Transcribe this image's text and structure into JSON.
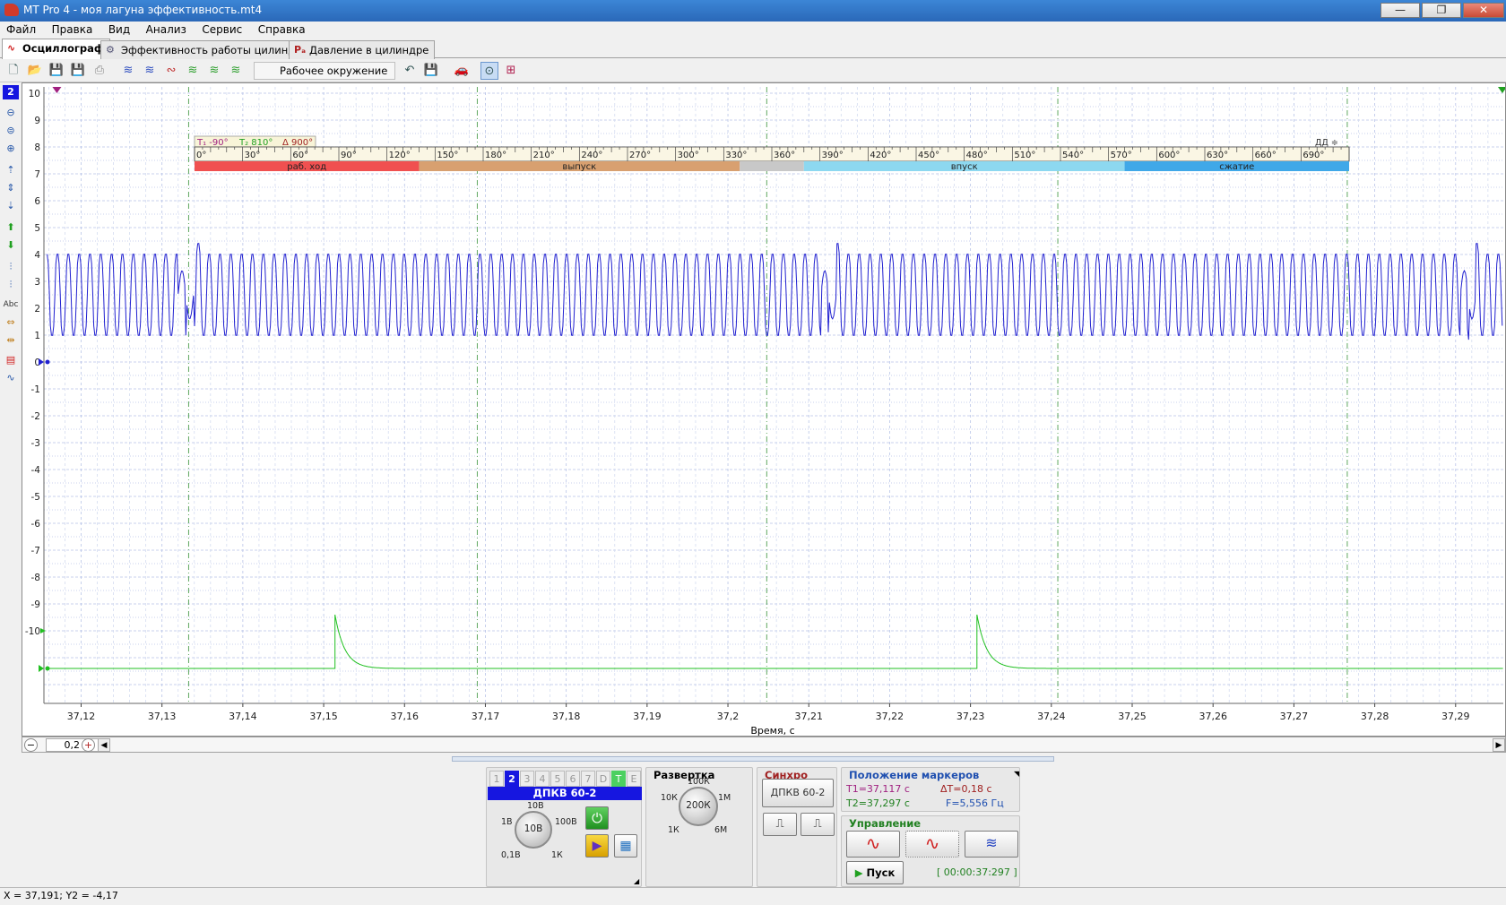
{
  "window": {
    "title": "MT Pro 4 - моя лагуна эффективность.mt4",
    "minimize": "—",
    "maximize": "❐",
    "close": "✕"
  },
  "menu": [
    "Файл",
    "Правка",
    "Вид",
    "Анализ",
    "Сервис",
    "Справка"
  ],
  "tabs": [
    {
      "label": "Осциллограф",
      "icon": "sine-wave-icon"
    },
    {
      "label": "Эффективность работы цилиндров",
      "icon": "gear-chart-icon"
    },
    {
      "label": "Давление в цилиндре",
      "icon": "pressure-icon"
    }
  ],
  "toolbar": {
    "workspace": "Рабочее окружение"
  },
  "plot": {
    "y_ticks": [
      "10",
      "9",
      "8",
      "7",
      "6",
      "5",
      "4",
      "3",
      "2",
      "1",
      "0",
      "-1",
      "-2",
      "-3",
      "-4",
      "-5",
      "-6",
      "-7",
      "-8",
      "-9",
      "-10"
    ],
    "x_ticks": [
      "37,12",
      "37,13",
      "37,14",
      "37,15",
      "37,16",
      "37,17",
      "37,18",
      "37,19",
      "37,2",
      "37,21",
      "37,22",
      "37,23",
      "37,24",
      "37,25",
      "37,26",
      "37,27",
      "37,28",
      "37,29"
    ],
    "x_title": "Время, с",
    "channel_badge": "2",
    "x_range": [
      37.1154,
      37.2959
    ]
  },
  "crank_overlay": {
    "t1_label": "T₁ -90°",
    "t2_label": "T₂ 810°",
    "delta_label": "Δ 900°",
    "ratio_label": "ДД ≑",
    "degree_labels": [
      "0°",
      "30°",
      "60°",
      "90°",
      "120°",
      "150°",
      "180°",
      "210°",
      "240°",
      "270°",
      "300°",
      "330°",
      "360°",
      "390°",
      "420°",
      "450°",
      "480°",
      "510°",
      "540°",
      "570°",
      "600°",
      "630°",
      "660°",
      "690°"
    ],
    "phases": [
      {
        "name": "раб. ход",
        "color": "#f05050",
        "from": 0,
        "to": 140
      },
      {
        "name": "выпуск",
        "color": "#d8a070",
        "from": 140,
        "to": 340
      },
      {
        "name": "",
        "color": "#c8c8c8",
        "from": 340,
        "to": 380
      },
      {
        "name": "впуск",
        "color": "#8dd8f0",
        "from": 380,
        "to": 580
      },
      {
        "name": "сжатие",
        "color": "#40a8e8",
        "from": 580,
        "to": 720
      }
    ]
  },
  "chart_data": {
    "type": "line",
    "xlabel": "Время, с",
    "xlim": [
      37.1154,
      37.2959
    ],
    "ylim": [
      -11.5,
      10
    ],
    "series": [
      {
        "name": "ДПКВ 60-2",
        "color": "#2020d0",
        "waveform": "square-ish crank sensor signal oscillating between ~1 V and ~4 V with ~0.00135 s period; missing-tooth gaps at 37,1333, 37,2128 and 37,2919 s; spikes to ~4,4 V after each gap",
        "y_min": 0.8,
        "y_max": 4.2,
        "gap_times": [
          37.1333,
          37.2128,
          37.2919
        ]
      },
      {
        "name": "",
        "color": "#20c020",
        "waveform": "flat baseline at -11,4 with exponential decaying pulses",
        "baseline": -11.4,
        "pulses": [
          {
            "t": 37.1514,
            "peak": -9.4
          },
          {
            "t": 37.2308,
            "peak": -9.4
          }
        ]
      }
    ],
    "cursors": {
      "t1": 37.117,
      "t2": 37.297
    }
  },
  "hscroll": {
    "zoom_value": "0,2 с",
    "zoom_out": "−",
    "zoom_in": "+"
  },
  "channel_panel": {
    "tabs": [
      "1",
      "2",
      "3",
      "4",
      "5",
      "6",
      "7",
      "D",
      "T",
      "E"
    ],
    "active": "2",
    "name": "ДПКВ 60-2",
    "knob": "10В",
    "labels": {
      "top": "10В",
      "left": "1В",
      "right": "100В",
      "bl": "0,1В",
      "br": "1К"
    }
  },
  "sweep_panel": {
    "title": "Развертка",
    "knob": "200К",
    "labels": {
      "top": "100К",
      "left": "10К",
      "right": "1М",
      "bl": "1К",
      "br": "6М"
    }
  },
  "sync_panel": {
    "title": "Синхро",
    "source": "ДПКВ 60-2"
  },
  "markers_panel": {
    "title": "Положение маркеров",
    "t1": "T1=37,117 с",
    "dt": "ΔT=0,18 с",
    "t2": "T2=37,297 с",
    "freq": "F=5,556 Гц"
  },
  "control_panel": {
    "title": "Управление",
    "start": "Пуск",
    "timer": "[ 00:00:37:297 ]"
  },
  "statusbar": {
    "coords": "X = 37,191; Y2 = -4,17"
  }
}
